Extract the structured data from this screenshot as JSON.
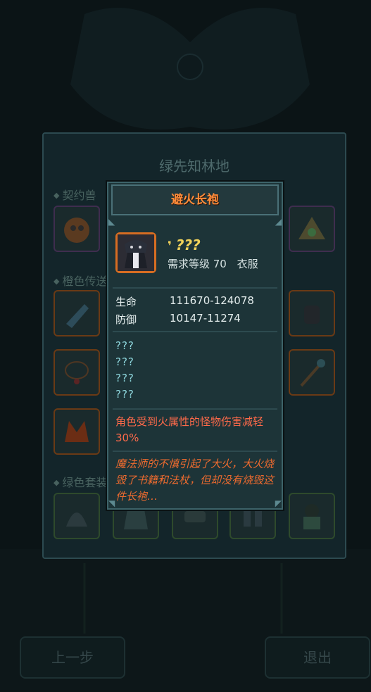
{
  "background": {
    "panel_title": "绿先知林地",
    "section_contract": "契约兽",
    "section_orange": "橙色传送",
    "section_green": "绿色套装",
    "back_button": "上一步",
    "exit_button": "退出"
  },
  "item": {
    "name": "避火长袍",
    "quality_name": "???",
    "required_level_label": "需求等级 70",
    "slot_type": "衣服",
    "stats": [
      {
        "label": "生命",
        "value": "111670-124078"
      },
      {
        "label": "防御",
        "value": "10147-11274"
      }
    ],
    "unknown_attrs": [
      "???",
      "???",
      "???",
      "???"
    ],
    "effect": "角色受到火属性的怪物伤害减轻30%",
    "lore": "魔法师的不慎引起了大火，大火烧毁了书籍和法杖，但却没有烧毁这件长袍…"
  },
  "colors": {
    "title": "#ff8c3a",
    "quality_name": "#f1d25a",
    "effect": "#ff6a4a",
    "lore": "#ee6b2f",
    "unknown": "#8fd8de"
  }
}
